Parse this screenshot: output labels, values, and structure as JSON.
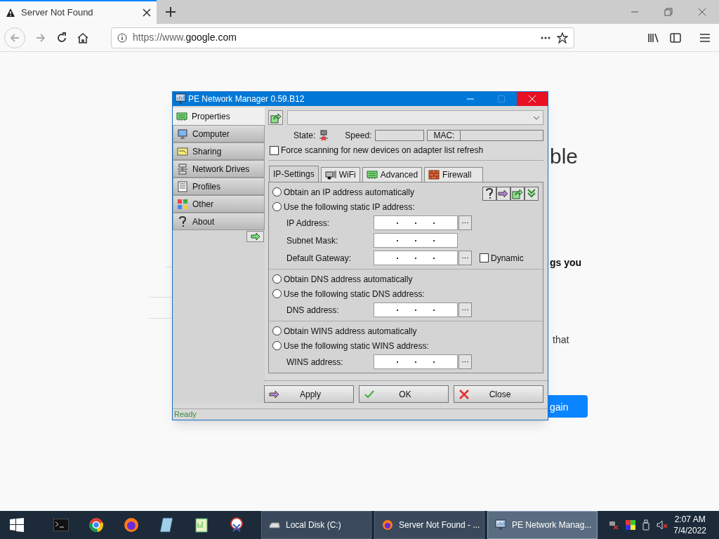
{
  "browser": {
    "tabs": [
      {
        "title": "Server Not Found",
        "selected": true
      }
    ],
    "url": {
      "scheme": "https://www.",
      "domain": "google.com"
    },
    "page_fragments": [
      {
        "kind": "heading",
        "text": "ble"
      },
      {
        "kind": "bold",
        "text": "gs you"
      },
      {
        "kind": "body",
        "text": "that"
      },
      {
        "kind": "button",
        "text": "gain"
      }
    ]
  },
  "dialog": {
    "title": "PE Network Manager 0.59.B12",
    "sidebar": [
      {
        "label": "Properties",
        "selected": true
      },
      {
        "label": "Computer",
        "selected": false
      },
      {
        "label": "Sharing",
        "selected": false
      },
      {
        "label": "Network Drives",
        "selected": false
      },
      {
        "label": "Profiles",
        "selected": false
      },
      {
        "label": "Other",
        "selected": false
      },
      {
        "label": "About",
        "selected": false
      }
    ],
    "state_label": "State:",
    "speed_label": "Speed:",
    "mac_label": "MAC:",
    "force_scan": {
      "label": "Force scanning for new devices on adapter list refresh",
      "checked": false
    },
    "tabs": [
      {
        "label": "IP-Settings",
        "selected": true
      },
      {
        "label": "WiFi",
        "selected": false
      },
      {
        "label": "Advanced",
        "selected": false
      },
      {
        "label": "Firewall",
        "selected": false
      }
    ],
    "sections": [
      {
        "options": [
          {
            "label": "Obtain an IP address automatically",
            "selected": false
          },
          {
            "label": "Use the following static IP address:",
            "selected": false
          }
        ],
        "fields": [
          {
            "label": "IP Address:",
            "browse": true
          },
          {
            "label": "Subnet Mask:",
            "browse": false
          },
          {
            "label": "Default Gateway:",
            "browse": true,
            "dynamic": {
              "label": "Dynamic",
              "checked": false
            }
          }
        ]
      },
      {
        "options": [
          {
            "label": "Obtain DNS address automatically",
            "selected": false
          },
          {
            "label": "Use the following static DNS address:",
            "selected": false
          }
        ],
        "fields": [
          {
            "label": "DNS address:",
            "browse": true
          }
        ]
      },
      {
        "options": [
          {
            "label": "Obtain WINS address automatically",
            "selected": false
          },
          {
            "label": "Use the following static WINS address:",
            "selected": false
          }
        ],
        "fields": [
          {
            "label": "WINS address:",
            "browse": true
          }
        ]
      }
    ],
    "buttons": [
      {
        "label": "Apply"
      },
      {
        "label": "OK"
      },
      {
        "label": "Close"
      }
    ],
    "status": "Ready"
  },
  "taskbar": {
    "tasks": [
      {
        "label": "Local Disk (C:)",
        "selected": false
      },
      {
        "label": "Server Not Found - ...",
        "selected": false
      },
      {
        "label": "PE Network Manag...",
        "selected": true
      }
    ],
    "time": "2:07 AM",
    "date": "7/4/2022"
  }
}
